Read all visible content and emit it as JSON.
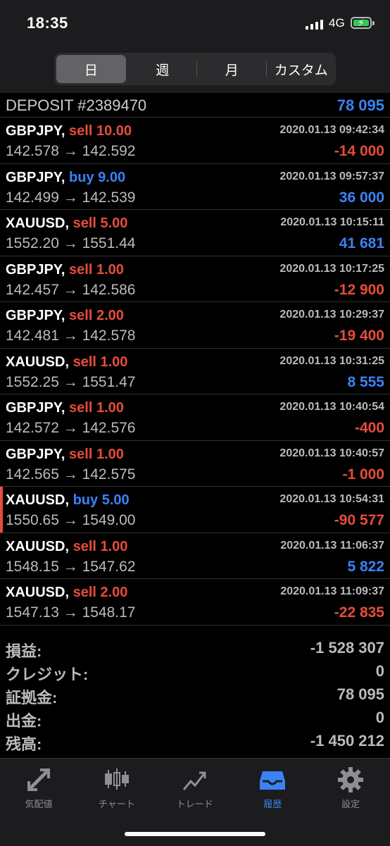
{
  "status": {
    "time": "18:35",
    "network": "4G"
  },
  "periods": [
    "日",
    "週",
    "月",
    "カスタム"
  ],
  "deposit": {
    "label": "DEPOSIT #2389470",
    "amount": "78 095"
  },
  "trades": [
    {
      "symbol": "GBPJPY,",
      "side": "sell",
      "volume": "10.00",
      "date": "2020.01.13 09:42:34",
      "prices": "142.578 → 142.592",
      "profit": "-14 000",
      "profit_sign": "neg"
    },
    {
      "symbol": "GBPJPY,",
      "side": "buy",
      "volume": "9.00",
      "date": "2020.01.13 09:57:37",
      "prices": "142.499 → 142.539",
      "profit": "36 000",
      "profit_sign": "pos"
    },
    {
      "symbol": "XAUUSD,",
      "side": "sell",
      "volume": "5.00",
      "date": "2020.01.13 10:15:11",
      "prices": "1552.20 → 1551.44",
      "profit": "41 681",
      "profit_sign": "pos"
    },
    {
      "symbol": "GBPJPY,",
      "side": "sell",
      "volume": "1.00",
      "date": "2020.01.13 10:17:25",
      "prices": "142.457 → 142.586",
      "profit": "-12 900",
      "profit_sign": "neg"
    },
    {
      "symbol": "GBPJPY,",
      "side": "sell",
      "volume": "2.00",
      "date": "2020.01.13 10:29:37",
      "prices": "142.481 → 142.578",
      "profit": "-19 400",
      "profit_sign": "neg"
    },
    {
      "symbol": "XAUUSD,",
      "side": "sell",
      "volume": "1.00",
      "date": "2020.01.13 10:31:25",
      "prices": "1552.25 → 1551.47",
      "profit": "8 555",
      "profit_sign": "pos"
    },
    {
      "symbol": "GBPJPY,",
      "side": "sell",
      "volume": "1.00",
      "date": "2020.01.13 10:40:54",
      "prices": "142.572 → 142.576",
      "profit": "-400",
      "profit_sign": "neg"
    },
    {
      "symbol": "GBPJPY,",
      "side": "sell",
      "volume": "1.00",
      "date": "2020.01.13 10:40:57",
      "prices": "142.565 → 142.575",
      "profit": "-1 000",
      "profit_sign": "neg"
    },
    {
      "symbol": "XAUUSD,",
      "side": "buy",
      "volume": "5.00",
      "date": "2020.01.13 10:54:31",
      "prices": "1550.65 → 1549.00",
      "profit": "-90 577",
      "profit_sign": "neg",
      "marked": true
    },
    {
      "symbol": "XAUUSD,",
      "side": "sell",
      "volume": "1.00",
      "date": "2020.01.13 11:06:37",
      "prices": "1548.15 → 1547.62",
      "profit": "5 822",
      "profit_sign": "pos"
    },
    {
      "symbol": "XAUUSD,",
      "side": "sell",
      "volume": "2.00",
      "date": "2020.01.13 11:09:37",
      "prices": "1547.13 → 1548.17",
      "profit": "-22 835",
      "profit_sign": "neg"
    }
  ],
  "summary": [
    {
      "label": "損益:",
      "value": "-1 528 307"
    },
    {
      "label": "クレジット:",
      "value": "0"
    },
    {
      "label": "証拠金:",
      "value": "78 095"
    },
    {
      "label": "出金:",
      "value": "0"
    },
    {
      "label": "残高:",
      "value": "-1 450 212"
    }
  ],
  "tabs": [
    {
      "label": "気配値",
      "icon": "quotes-arrows-icon"
    },
    {
      "label": "チャート",
      "icon": "candlestick-chart-icon"
    },
    {
      "label": "トレード",
      "icon": "trade-line-icon"
    },
    {
      "label": "履歴",
      "icon": "history-tray-icon",
      "active": true
    },
    {
      "label": "設定",
      "icon": "gear-icon"
    }
  ],
  "colors": {
    "sell": "#e74c3c",
    "buy": "#3b82f6",
    "tab_active": "#3b82f6"
  }
}
